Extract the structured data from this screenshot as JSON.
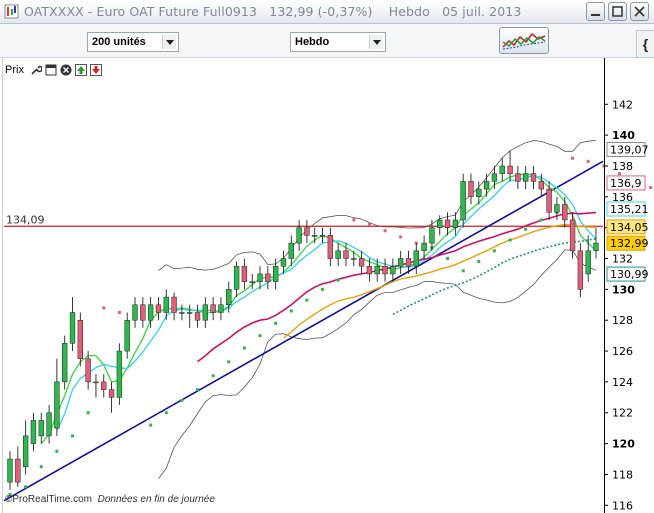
{
  "window": {
    "title": "OATXXXX - Euro OAT Future Full0913",
    "price": "132,99 (-0,37%)",
    "period": "Hebdo",
    "date": "05 juil. 2013",
    "icon": "chart-app-icon",
    "controls": [
      "minimize-icon",
      "maximize-icon",
      "close-icon"
    ]
  },
  "toolbar": {
    "units_select": "200 unités",
    "period_select": "Hebdo",
    "indicator_icon": "indicators-icon",
    "side_tab": "{"
  },
  "chart_header": {
    "label": "Prix",
    "icons": [
      "wrench-icon",
      "window-icon",
      "close-circle-icon",
      "up-arrow-icon",
      "down-arrow-icon"
    ]
  },
  "footer": {
    "brand": "©ProRealTime.com",
    "note": "Données en fin de journée"
  },
  "colors": {
    "up": "#2db84b",
    "down": "#e0607a",
    "trendline": "#1010a0",
    "hline": "#cc2020",
    "ma_green": "#44d84a",
    "ma_cyan": "#40d4ee",
    "ma_magenta": "#d0106a",
    "ma_orange": "#f0a000",
    "ma_teal": "#208f8f"
  },
  "chart_data": {
    "type": "candlestick",
    "ylim": [
      115.5,
      145
    ],
    "yticks": [
      116,
      118,
      120,
      122,
      124,
      126,
      128,
      130,
      132,
      134,
      136,
      138,
      140,
      142
    ],
    "ytick_labels": [
      "116",
      "118",
      "120",
      "122",
      "124",
      "126",
      "128",
      "130",
      "132",
      "134",
      "136",
      "138",
      "140",
      "142"
    ],
    "bold_ticks": [
      "120",
      "130",
      "140"
    ],
    "hline": {
      "value": 134.09,
      "label": "134,09"
    },
    "last_values": [
      {
        "label": "139,07",
        "value": 139.07,
        "color": "#ffffff",
        "border": "#888888",
        "text": "#000000"
      },
      {
        "label": "136,9",
        "value": 136.9,
        "color": "#ffffff",
        "border": "#e0607a",
        "text": "#000000"
      },
      {
        "label": "135,21",
        "value": 135.21,
        "color": "#ffffff",
        "border": "#40d4ee",
        "text": "#000000"
      },
      {
        "label": "134,05",
        "value": 134.05,
        "color": "#ffe880",
        "border": "#f0a000",
        "text": "#000000"
      },
      {
        "label": "132,99",
        "value": 132.99,
        "color": "#ffd000",
        "border": "#e0a000",
        "text": "#000000"
      },
      {
        "label": "130,99",
        "value": 130.99,
        "color": "#ffffff",
        "border": "#208f8f",
        "text": "#000000"
      }
    ],
    "candles": [
      [
        117.5,
        119.0,
        119.5,
        117.0
      ],
      [
        119.0,
        117.5,
        119.8,
        117.2
      ],
      [
        118.5,
        120.5,
        121.5,
        118.0
      ],
      [
        120.0,
        121.5,
        122.0,
        119.5
      ],
      [
        120.5,
        121.5,
        122.0,
        120.0
      ],
      [
        120.5,
        122.0,
        122.5,
        120.0
      ],
      [
        121.0,
        124.0,
        125.5,
        120.5
      ],
      [
        124.0,
        126.5,
        127.0,
        123.5
      ],
      [
        126.5,
        128.5,
        129.5,
        126.0
      ],
      [
        128.0,
        125.5,
        128.5,
        125.0
      ],
      [
        125.5,
        124.0,
        126.0,
        123.5
      ],
      [
        124.0,
        124.0,
        124.5,
        123.0
      ],
      [
        124.0,
        123.5,
        124.5,
        123.0
      ],
      [
        123.5,
        123.0,
        124.0,
        122.0
      ],
      [
        123.0,
        126.0,
        126.5,
        122.5
      ],
      [
        126.0,
        128.0,
        128.5,
        125.5
      ],
      [
        128.0,
        129.0,
        129.5,
        127.5
      ],
      [
        129.0,
        128.0,
        129.5,
        127.5
      ],
      [
        128.0,
        129.0,
        129.5,
        127.5
      ],
      [
        129.0,
        128.5,
        129.5,
        128.0
      ],
      [
        128.5,
        129.5,
        130.0,
        128.0
      ],
      [
        129.5,
        128.5,
        129.8,
        128.0
      ],
      [
        128.5,
        128.5,
        129.0,
        128.0
      ],
      [
        128.5,
        128.5,
        129.0,
        127.5
      ],
      [
        128.5,
        128.0,
        129.0,
        127.5
      ],
      [
        128.0,
        129.0,
        129.5,
        127.5
      ],
      [
        129.0,
        128.5,
        129.5,
        128.0
      ],
      [
        128.5,
        129.0,
        129.5,
        128.0
      ],
      [
        129.0,
        130.0,
        130.5,
        128.5
      ],
      [
        130.0,
        131.5,
        131.8,
        129.5
      ],
      [
        131.5,
        130.5,
        132.0,
        130.0
      ],
      [
        130.5,
        130.5,
        131.0,
        130.0
      ],
      [
        130.5,
        131.0,
        131.5,
        130.0
      ],
      [
        131.0,
        130.5,
        131.5,
        130.0
      ],
      [
        130.5,
        131.5,
        132.0,
        130.0
      ],
      [
        131.5,
        132.0,
        132.5,
        131.0
      ],
      [
        132.0,
        133.0,
        133.5,
        131.5
      ],
      [
        133.0,
        134.0,
        134.5,
        132.5
      ],
      [
        134.0,
        133.5,
        134.5,
        133.0
      ],
      [
        133.5,
        133.5,
        134.0,
        133.0
      ],
      [
        133.5,
        133.5,
        134.0,
        133.0
      ],
      [
        133.5,
        132.0,
        134.0,
        131.5
      ],
      [
        132.0,
        132.5,
        133.0,
        131.5
      ],
      [
        132.5,
        132.0,
        133.0,
        131.5
      ],
      [
        132.0,
        132.0,
        132.5,
        131.5
      ],
      [
        132.0,
        131.5,
        132.5,
        131.0
      ],
      [
        131.5,
        131.0,
        132.0,
        130.5
      ],
      [
        131.0,
        131.5,
        132.0,
        130.5
      ],
      [
        131.5,
        131.0,
        132.0,
        130.5
      ],
      [
        131.0,
        131.5,
        132.0,
        130.5
      ],
      [
        131.5,
        132.0,
        132.5,
        131.0
      ],
      [
        132.0,
        131.5,
        132.5,
        131.0
      ],
      [
        131.5,
        132.5,
        133.0,
        131.0
      ],
      [
        132.5,
        133.0,
        133.5,
        132.0
      ],
      [
        133.0,
        134.0,
        134.5,
        132.5
      ],
      [
        134.0,
        134.5,
        134.8,
        133.5
      ],
      [
        134.5,
        134.0,
        135.0,
        133.5
      ],
      [
        134.0,
        134.5,
        135.0,
        133.5
      ],
      [
        134.5,
        137.0,
        137.5,
        134.0
      ],
      [
        137.0,
        136.0,
        137.5,
        135.5
      ],
      [
        136.0,
        136.5,
        137.0,
        135.5
      ],
      [
        136.5,
        137.0,
        137.5,
        136.0
      ],
      [
        137.0,
        137.5,
        138.0,
        136.5
      ],
      [
        137.5,
        138.0,
        138.5,
        137.0
      ],
      [
        138.0,
        137.5,
        139.0,
        137.0
      ],
      [
        137.5,
        137.0,
        138.0,
        136.5
      ],
      [
        137.0,
        137.5,
        138.0,
        136.5
      ],
      [
        137.5,
        137.0,
        138.0,
        136.5
      ],
      [
        137.0,
        136.5,
        137.5,
        136.0
      ],
      [
        136.5,
        135.0,
        137.0,
        134.5
      ],
      [
        135.0,
        135.5,
        136.0,
        134.5
      ],
      [
        135.5,
        134.5,
        136.0,
        134.0
      ],
      [
        134.5,
        132.5,
        135.0,
        132.0
      ],
      [
        132.5,
        130.0,
        133.0,
        129.5
      ],
      [
        131.0,
        132.5,
        133.5,
        130.5
      ],
      [
        132.5,
        133.0,
        134.0,
        132.0
      ]
    ],
    "sar_points": [
      [
        0,
        116.7
      ],
      [
        2,
        117.2
      ],
      [
        4,
        118.5
      ],
      [
        6,
        119.5
      ],
      [
        8,
        120.5
      ],
      [
        10,
        122.0
      ],
      [
        12,
        128.8
      ],
      [
        14,
        128.5
      ],
      [
        16,
        128.2
      ],
      [
        18,
        121.2
      ],
      [
        20,
        122.0
      ],
      [
        22,
        122.8
      ],
      [
        24,
        123.5
      ],
      [
        26,
        124.4
      ],
      [
        28,
        125.3
      ],
      [
        30,
        126.2
      ],
      [
        32,
        127.0
      ],
      [
        34,
        127.8
      ],
      [
        36,
        128.6
      ],
      [
        38,
        129.3
      ],
      [
        40,
        130.0
      ],
      [
        42,
        130.6
      ],
      [
        44,
        134.5
      ],
      [
        46,
        134.2
      ],
      [
        48,
        133.8
      ],
      [
        50,
        133.4
      ],
      [
        52,
        133.0
      ],
      [
        54,
        132.7
      ],
      [
        56,
        132.0
      ],
      [
        58,
        131.2
      ],
      [
        60,
        131.8
      ],
      [
        62,
        132.5
      ],
      [
        64,
        133.2
      ],
      [
        66,
        133.9
      ],
      [
        68,
        134.5
      ],
      [
        70,
        135.0
      ],
      [
        72,
        138.5
      ],
      [
        74,
        138.3
      ],
      [
        76,
        138.0
      ],
      [
        78,
        137.5
      ],
      [
        80,
        137.0
      ],
      [
        82,
        136.6
      ]
    ]
  }
}
